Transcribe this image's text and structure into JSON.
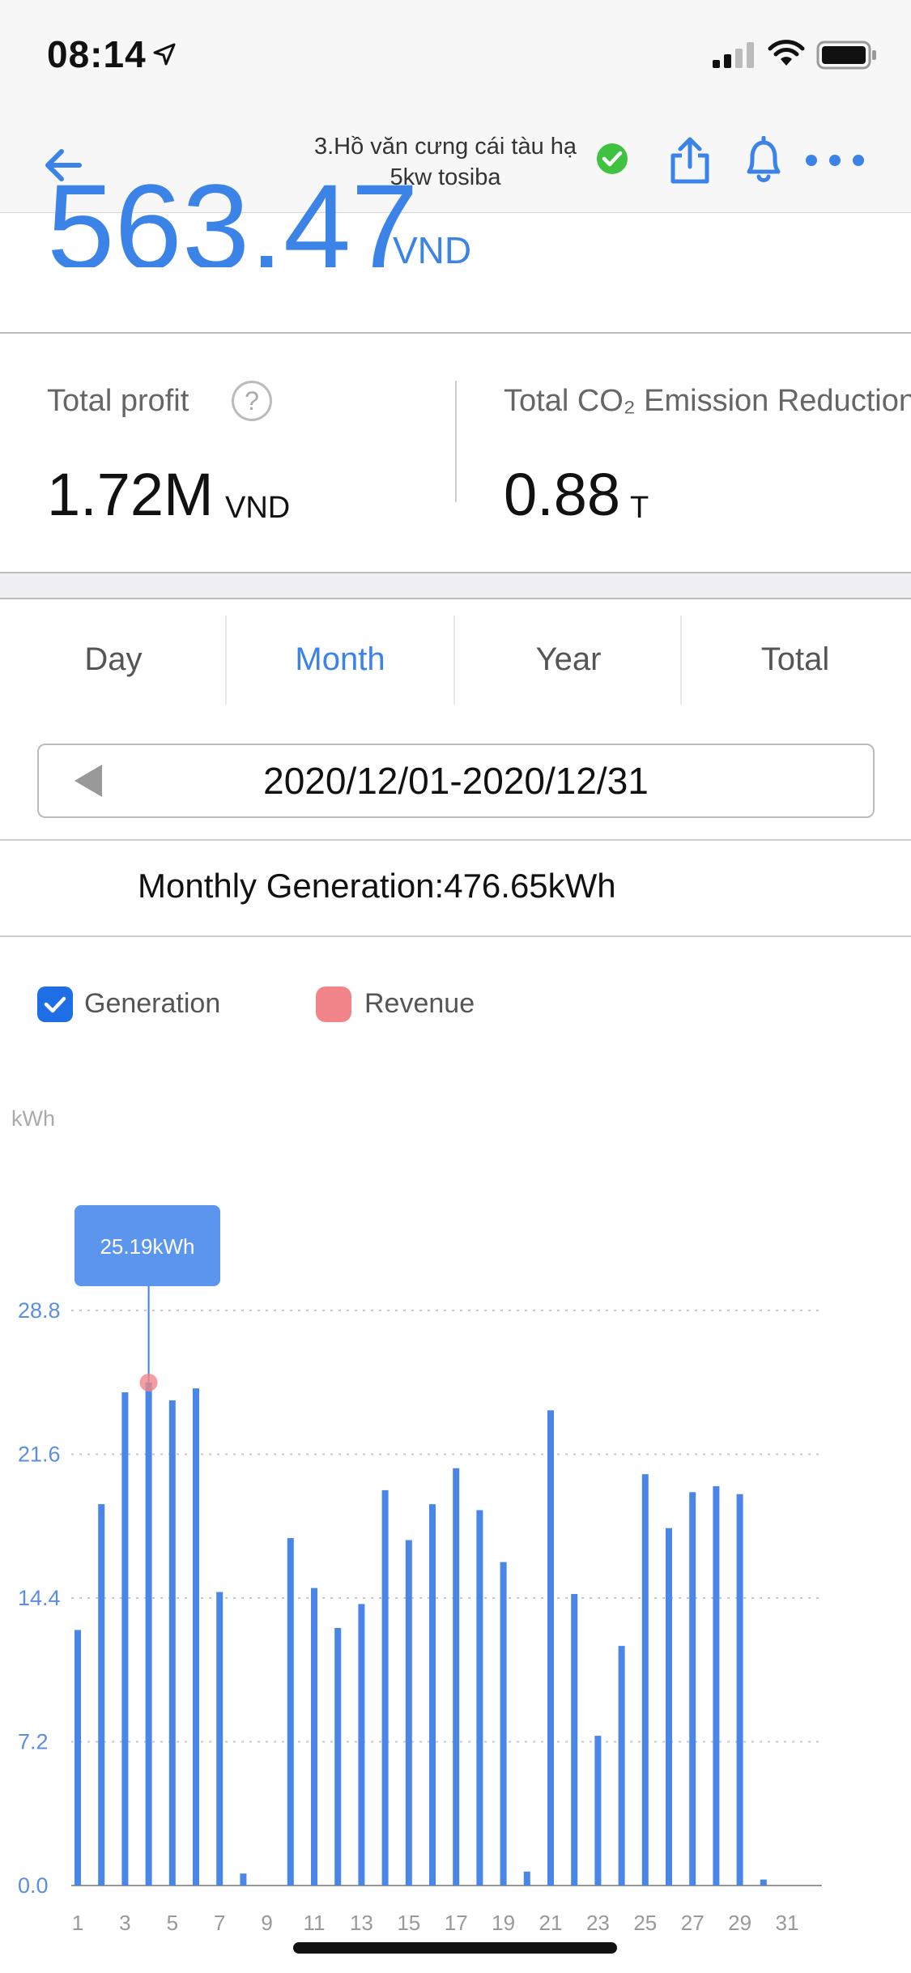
{
  "status_bar": {
    "time": "08:14"
  },
  "nav": {
    "title": "3.Hồ văn cưng cái tàu hạ 5kw tosiba"
  },
  "summary": {
    "revenue_value": "563.47",
    "revenue_unit": "VND",
    "total_profit_label": "Total profit",
    "total_profit_value": "1.72M",
    "total_profit_unit": "VND",
    "co2_label": "Total CO₂ Emission Reduction",
    "co2_value": "0.88",
    "co2_unit": "T",
    "help_symbol": "?"
  },
  "tabs": [
    {
      "label": "Day"
    },
    {
      "label": "Month",
      "active": true
    },
    {
      "label": "Year"
    },
    {
      "label": "Total"
    }
  ],
  "date_range": "2020/12/01-2020/12/31",
  "monthly_generation": "Monthly Generation:476.65kWh",
  "legend": {
    "generation": "Generation",
    "revenue": "Revenue"
  },
  "colors": {
    "accent": "#3c83e8",
    "bar": "#4a86e8",
    "revenue": "#f08488"
  },
  "chart_data": {
    "type": "bar",
    "ylabel": "kWh",
    "ylim": [
      0,
      28.8
    ],
    "yticks": [
      "0.0",
      "7.2",
      "14.4",
      "21.6",
      "28.8"
    ],
    "categories": [
      "1",
      "2",
      "3",
      "4",
      "5",
      "6",
      "7",
      "8",
      "9",
      "10",
      "11",
      "12",
      "13",
      "14",
      "15",
      "16",
      "17",
      "18",
      "19",
      "20",
      "21",
      "22",
      "23",
      "24",
      "25",
      "26",
      "27",
      "28",
      "29",
      "30",
      "31"
    ],
    "xtick_labels": [
      "1",
      "3",
      "5",
      "7",
      "9",
      "11",
      "13",
      "15",
      "17",
      "19",
      "21",
      "23",
      "25",
      "27",
      "29",
      "31"
    ],
    "series": [
      {
        "name": "Generation",
        "values": [
          12.8,
          19.1,
          24.7,
          25.19,
          24.3,
          24.9,
          14.7,
          0.6,
          0,
          17.4,
          14.9,
          12.9,
          14.1,
          19.8,
          17.3,
          19.1,
          20.9,
          18.8,
          16.2,
          0.7,
          23.8,
          14.6,
          7.5,
          12.0,
          20.6,
          17.9,
          19.7,
          20.0,
          19.6,
          0.3,
          0
        ]
      }
    ],
    "tooltip": {
      "index": 3,
      "text": "25.19kWh"
    },
    "grid": true
  }
}
